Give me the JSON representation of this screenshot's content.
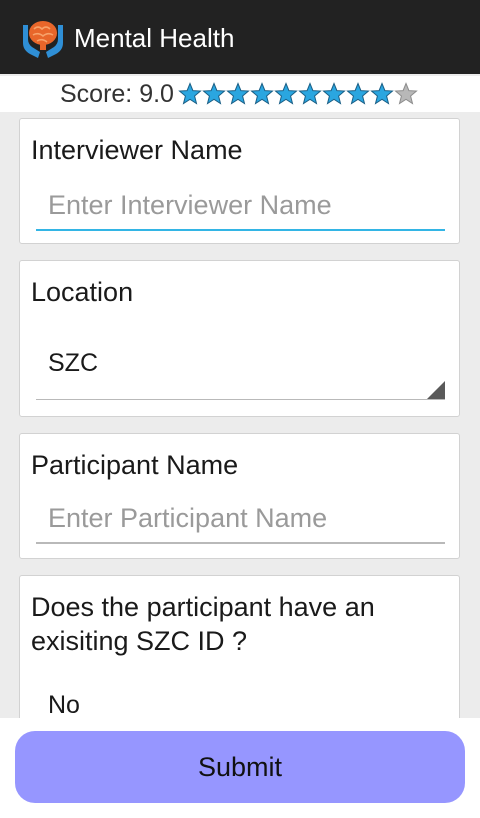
{
  "app": {
    "title": "Mental Health",
    "icon": "hands-holding-brain-icon",
    "actionbar_color": "#222222"
  },
  "score": {
    "prefix": "Score: ",
    "value": "9.0",
    "stars_filled": 9,
    "stars_total": 10,
    "star_color": "#2aa6e0"
  },
  "form": {
    "interviewer_name": {
      "label": "Interviewer Name",
      "placeholder": "Enter Interviewer Name",
      "value": ""
    },
    "location": {
      "label": "Location",
      "value": "SZC"
    },
    "participant_name": {
      "label": "Participant Name",
      "placeholder": "Enter Participant Name",
      "value": ""
    },
    "existing_szc_id": {
      "label": "Does the participant have an\nexisiting SZC ID ?",
      "value": "No"
    }
  },
  "submit": {
    "label": "Submit",
    "color": "#9696ff"
  }
}
